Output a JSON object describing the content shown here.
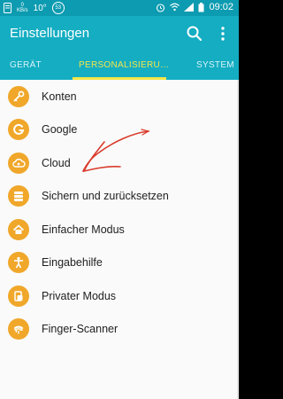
{
  "status_bar": {
    "data_speed_value": "0",
    "data_speed_unit": "KB/s",
    "temperature": "10°",
    "badge": "53",
    "time": "09:02"
  },
  "app_bar": {
    "title": "Einstellungen",
    "search_icon": "search-icon",
    "more_icon": "more-vertical-icon"
  },
  "tabs": [
    {
      "label": "GERÄT",
      "active": false
    },
    {
      "label": "PERSONALISIERU…",
      "active": true
    },
    {
      "label": "SYSTEM",
      "active": false
    }
  ],
  "settings": [
    {
      "label": "Konten",
      "icon": "key-icon"
    },
    {
      "label": "Google",
      "icon": "google-icon"
    },
    {
      "label": "Cloud",
      "icon": "cloud-icon"
    },
    {
      "label": "Sichern und zurücksetzen",
      "icon": "backup-icon"
    },
    {
      "label": "Einfacher Modus",
      "icon": "home-icon"
    },
    {
      "label": "Eingabehilfe",
      "icon": "accessibility-icon"
    },
    {
      "label": "Privater Modus",
      "icon": "private-mode-icon"
    },
    {
      "label": "Finger-Scanner",
      "icon": "fingerprint-icon"
    }
  ],
  "colors": {
    "header": "#14adc2",
    "status_bar": "#0c9bb0",
    "accent_tab": "#f4e64a",
    "icon_bg": "#f0a72a",
    "annotation": "#d93a2b"
  }
}
